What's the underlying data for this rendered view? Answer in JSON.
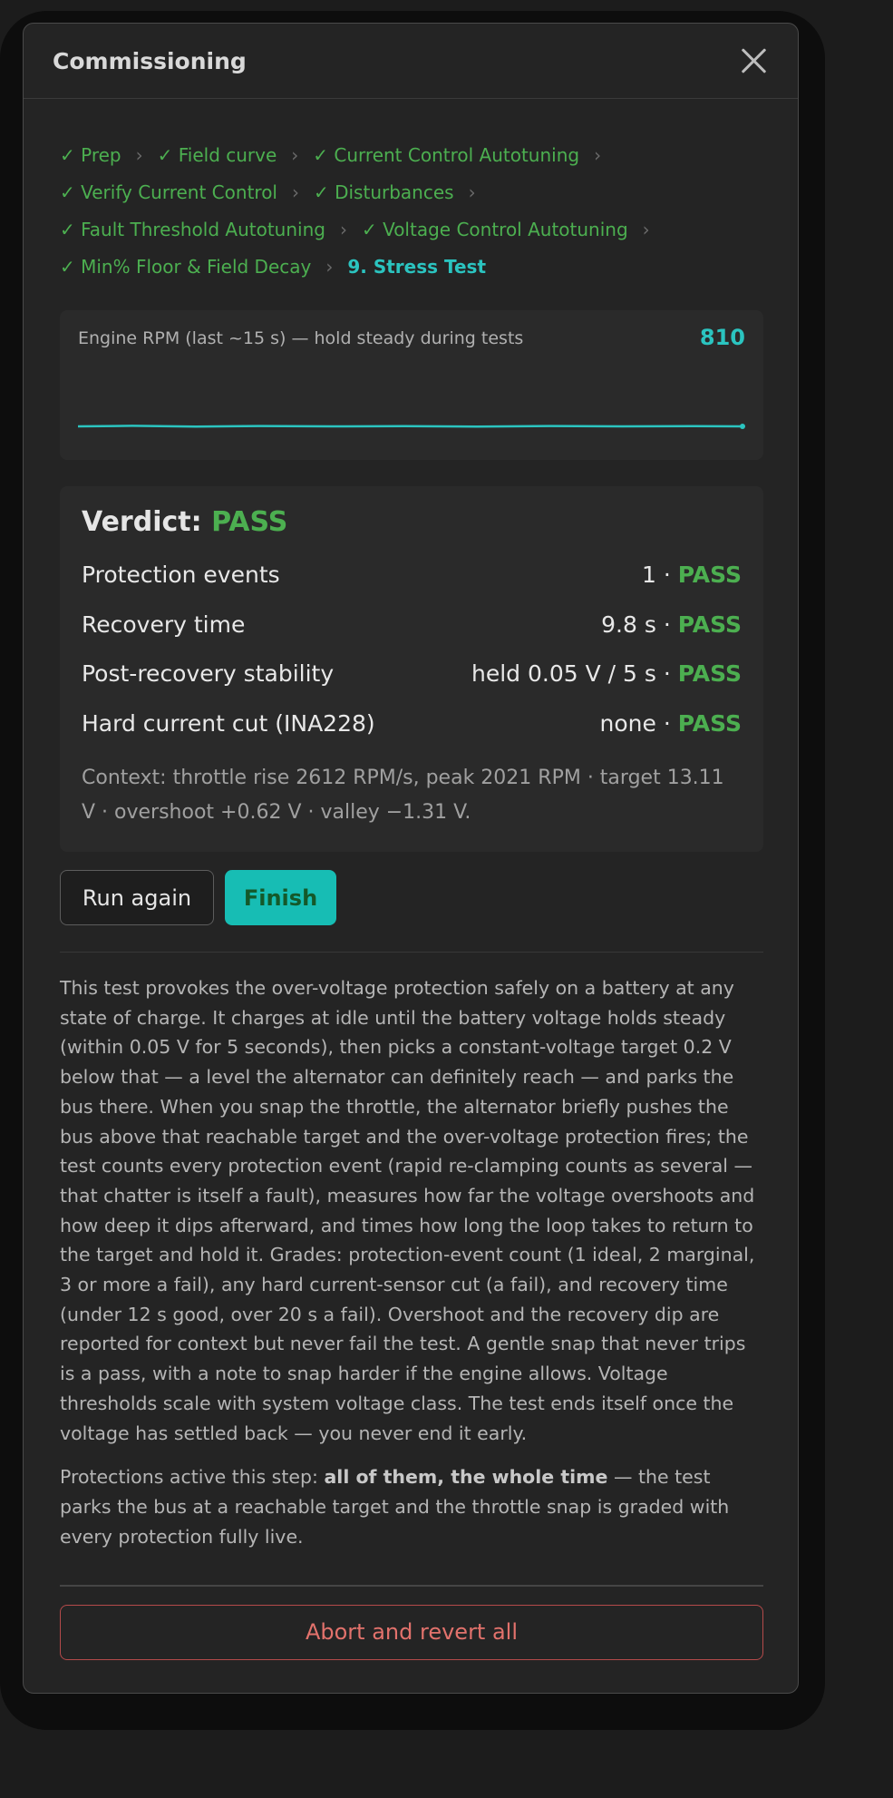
{
  "modal": {
    "title": "Commissioning"
  },
  "steps": [
    {
      "label": "✓ Prep",
      "state": "done"
    },
    {
      "label": "✓ Field curve",
      "state": "done"
    },
    {
      "label": "✓ Current Control Autotuning",
      "state": "done"
    },
    {
      "label": "✓ Verify Current Control",
      "state": "done"
    },
    {
      "label": "✓ Disturbances",
      "state": "done"
    },
    {
      "label": "✓ Fault Threshold Autotuning",
      "state": "done"
    },
    {
      "label": "✓ Voltage Control Autotuning",
      "state": "done"
    },
    {
      "label": "✓ Min% Floor & Field Decay",
      "state": "done"
    },
    {
      "label": "9. Stress Test",
      "state": "current"
    }
  ],
  "step_separator": "›",
  "rpm": {
    "label": "Engine RPM (last ~15 s) — hold steady during tests",
    "value": "810"
  },
  "verdict": {
    "prefix": "Verdict:",
    "result": "PASS",
    "metrics": [
      {
        "label": "Protection events",
        "value": "1 ·",
        "grade": "PASS"
      },
      {
        "label": "Recovery time",
        "value": "9.8 s ·",
        "grade": "PASS"
      },
      {
        "label": "Post-recovery stability",
        "value": "held 0.05 V / 5 s ·",
        "grade": "PASS"
      },
      {
        "label": "Hard current cut (INA228)",
        "value": "none ·",
        "grade": "PASS"
      }
    ],
    "context": "Context: throttle rise 2612 RPM/s, peak 2021 RPM · target 13.11 V · overshoot +0.62 V · valley −1.31 V."
  },
  "buttons": {
    "run_again": "Run again",
    "finish": "Finish",
    "abort": "Abort and revert all"
  },
  "description": {
    "main": "This test provokes the over-voltage protection safely on a battery at any state of charge. It charges at idle until the battery voltage holds steady (within 0.05 V for 5 seconds), then picks a constant-voltage target 0.2 V below that — a level the alternator can definitely reach — and parks the bus there. When you snap the throttle, the alternator briefly pushes the bus above that reachable target and the over-voltage protection fires; the test counts every protection event (rapid re-clamping counts as several — that chatter is itself a fault), measures how far the voltage overshoots and how deep it dips afterward, and times how long the loop takes to return to the target and hold it. Grades: protection-event count (1 ideal, 2 marginal, 3 or more a fail), any hard current-sensor cut (a fail), and recovery time (under 12 s good, over 20 s a fail). Overshoot and the recovery dip are reported for context but never fail the test. A gentle snap that never trips is a pass, with a note to snap harder if the engine allows. Voltage thresholds scale with system voltage class. The test ends itself once the voltage has settled back — you never end it early.",
    "protections_prefix": "Protections active this step:",
    "protections_bold": "all of them, the whole time",
    "protections_suffix": "— the test parks the bus at a reachable target and the throttle snap is graded with every protection fully live."
  },
  "colors": {
    "done": "#4caf50",
    "current": "#2bc4c0",
    "finish_bg": "#17bdb4",
    "abort": "#e2726c"
  }
}
